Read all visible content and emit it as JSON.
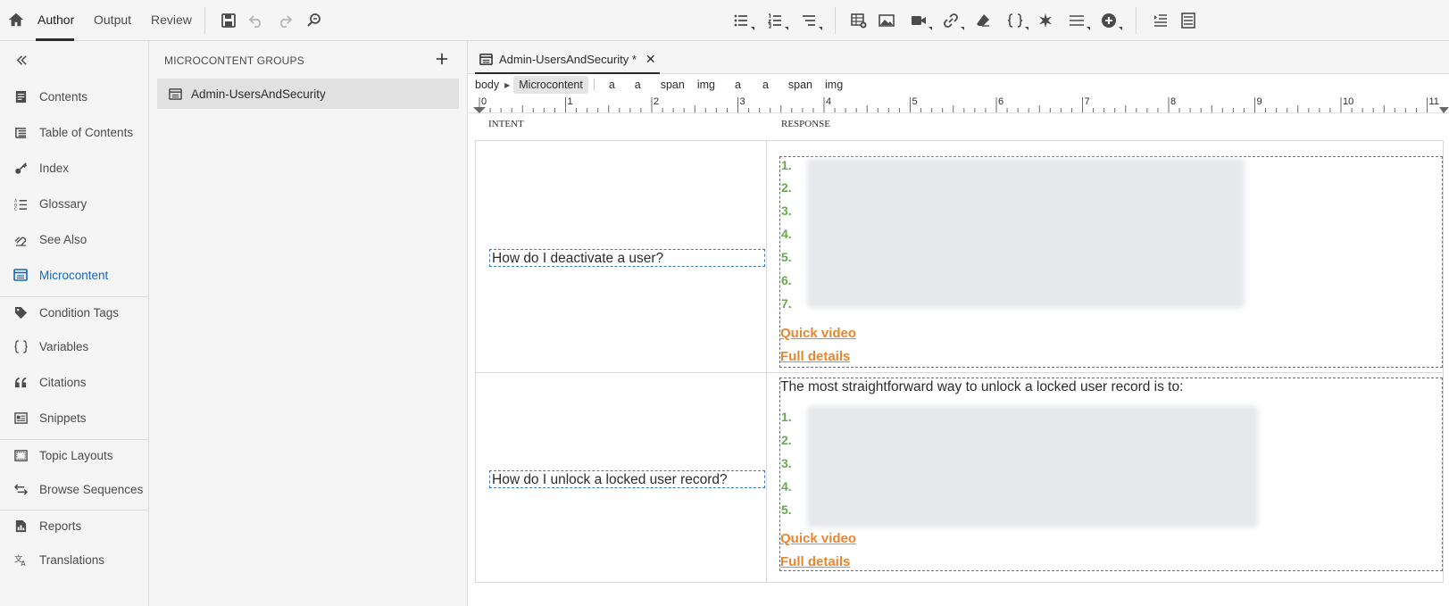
{
  "top_tabs": [
    {
      "label": "Author",
      "active": true
    },
    {
      "label": "Output",
      "active": false
    },
    {
      "label": "Review",
      "active": false
    }
  ],
  "toolbar_icons": [
    "save-icon",
    "undo-icon",
    "redo-icon",
    "find-replace-icon",
    "bulleted-list-icon",
    "numbered-list-icon",
    "multilevel-list-icon",
    "insert-table-icon",
    "insert-image-icon",
    "insert-video-icon",
    "insert-link-icon",
    "eraser-icon",
    "variable-icon",
    "symbol-icon",
    "horizontal-line-icon",
    "insert-plus-icon",
    "indent-icon",
    "outdent-icon"
  ],
  "nav": {
    "items": [
      {
        "label": "Contents",
        "icon": "contents-icon"
      },
      {
        "label": "Table of Contents",
        "icon": "toc-icon"
      },
      {
        "label": "Index",
        "icon": "key-icon"
      },
      {
        "label": "Glossary",
        "icon": "glossary-icon"
      },
      {
        "label": "See Also",
        "icon": "see-also-icon"
      },
      {
        "label": "Microcontent",
        "icon": "microcontent-icon",
        "active": true
      },
      {
        "label": "Condition Tags",
        "icon": "tag-icon"
      },
      {
        "label": "Variables",
        "icon": "braces-icon"
      },
      {
        "label": "Citations",
        "icon": "quote-icon"
      },
      {
        "label": "Snippets",
        "icon": "snippet-icon"
      },
      {
        "label": "Topic Layouts",
        "icon": "layout-icon"
      },
      {
        "label": "Browse Sequences",
        "icon": "arrows-icon"
      },
      {
        "label": "Reports",
        "icon": "report-icon"
      },
      {
        "label": "Translations",
        "icon": "translate-icon"
      }
    ]
  },
  "groups": {
    "title": "MICROCONTENT GROUPS",
    "items": [
      {
        "label": "Admin-UsersAndSecurity"
      }
    ]
  },
  "editor": {
    "tab_label": "Admin-UsersAndSecurity *",
    "tab_close": "✕",
    "breadcrumbs": [
      "body",
      "Microcontent",
      "a",
      "a",
      "span",
      "img",
      "a",
      "a",
      "span",
      "img"
    ],
    "ruler_labels": [
      "0",
      "1",
      "2",
      "3",
      "4",
      "5",
      "6",
      "7",
      "8",
      "9",
      "10",
      "11"
    ],
    "columns": {
      "intent": "INTENT",
      "response": "RESPONSE"
    },
    "rows": [
      {
        "intent": "How do I deactivate a user?",
        "lead": "",
        "steps": [
          "1.",
          "2.",
          "3.",
          "4.",
          "5.",
          "6.",
          "7."
        ],
        "links": [
          "Quick video",
          "Full details"
        ]
      },
      {
        "intent": "How do I unlock a locked user record?",
        "lead": "The most straightforward way to unlock a locked user record is to:",
        "steps": [
          "1.",
          "2.",
          "3.",
          "4.",
          "5."
        ],
        "links": [
          "Quick video",
          "Full details"
        ]
      }
    ]
  },
  "colors": {
    "accent": "#1467c0",
    "link": "#e6862f",
    "step_number": "#6aa84f",
    "dashed_border": "#3a7bbf"
  }
}
